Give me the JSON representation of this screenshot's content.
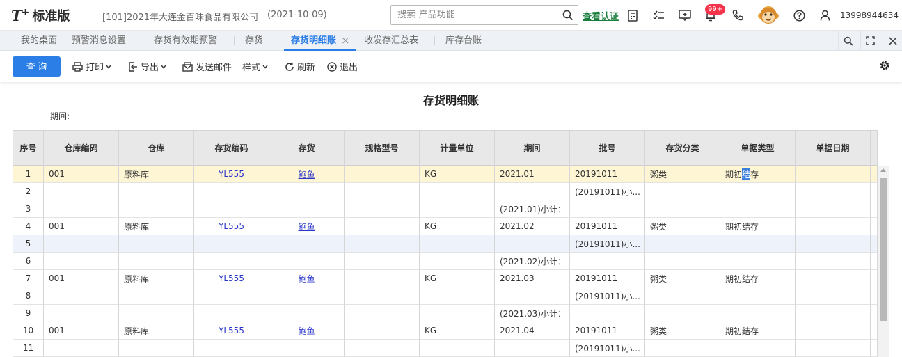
{
  "header": {
    "logo_t": "T",
    "logo_plus": "+",
    "logo_name": "标准版",
    "company": "[101]2021年大连金百味食品有限公司",
    "date": "(2021-10-09)",
    "search_placeholder": "搜索-产品功能",
    "verify_link": "查看认证",
    "notification_badge": "99+",
    "phone": "13998944634",
    "icons": [
      "calculator-icon",
      "checklist-icon",
      "message-icon",
      "bell-icon",
      "phone-icon",
      "avatar",
      "help-icon",
      "user-icon"
    ]
  },
  "tabs": {
    "items": [
      "我的桌面",
      "预警消息设置",
      "存货有效期预警",
      "存货",
      "存货明细账",
      "收发存汇总表",
      "库存台账"
    ],
    "active": "存货明细账",
    "close_glyph": "×"
  },
  "toolbar": {
    "query": "查 询",
    "print": "打印",
    "export": "导出",
    "send_email": "发送邮件",
    "style": "样式",
    "refresh": "刷新",
    "exit": "退出"
  },
  "report": {
    "title": "存货明细账",
    "period_label": "期间:"
  },
  "table": {
    "columns": [
      "序号",
      "仓库编码",
      "仓库",
      "存货编码",
      "存货",
      "规格型号",
      "计量单位",
      "期间",
      "批号",
      "存货分类",
      "单据类型",
      "单据日期"
    ],
    "rows": [
      {
        "seq": "1",
        "wh_code": "001",
        "wh": "原料库",
        "inv_code": "YL555",
        "inv": "鲍鱼",
        "spec": "",
        "unit": "KG",
        "period": "2021.01",
        "batch": "20191011",
        "category": "粥类",
        "doc_type_a": "期初",
        "doc_type_hl": "结",
        "doc_type_b": "存",
        "doc_date": ""
      },
      {
        "seq": "2",
        "wh_code": "",
        "wh": "",
        "inv_code": "",
        "inv": "",
        "spec": "",
        "unit": "",
        "period": "",
        "batch": "(20191011)小...",
        "category": "",
        "doc_type_a": "",
        "doc_type_hl": "",
        "doc_type_b": "",
        "doc_date": ""
      },
      {
        "seq": "3",
        "wh_code": "",
        "wh": "",
        "inv_code": "",
        "inv": "",
        "spec": "",
        "unit": "",
        "period": "(2021.01)小计：",
        "batch": "",
        "category": "",
        "doc_type_a": "",
        "doc_type_hl": "",
        "doc_type_b": "",
        "doc_date": ""
      },
      {
        "seq": "4",
        "wh_code": "001",
        "wh": "原料库",
        "inv_code": "YL555",
        "inv": "鲍鱼",
        "spec": "",
        "unit": "KG",
        "period": "2021.02",
        "batch": "20191011",
        "category": "粥类",
        "doc_type_a": "期初结存",
        "doc_type_hl": "",
        "doc_type_b": "",
        "doc_date": ""
      },
      {
        "seq": "5",
        "wh_code": "",
        "wh": "",
        "inv_code": "",
        "inv": "",
        "spec": "",
        "unit": "",
        "period": "",
        "batch": "(20191011)小...",
        "category": "",
        "doc_type_a": "",
        "doc_type_hl": "",
        "doc_type_b": "",
        "doc_date": ""
      },
      {
        "seq": "6",
        "wh_code": "",
        "wh": "",
        "inv_code": "",
        "inv": "",
        "spec": "",
        "unit": "",
        "period": "(2021.02)小计：",
        "batch": "",
        "category": "",
        "doc_type_a": "",
        "doc_type_hl": "",
        "doc_type_b": "",
        "doc_date": ""
      },
      {
        "seq": "7",
        "wh_code": "001",
        "wh": "原料库",
        "inv_code": "YL555",
        "inv": "鲍鱼",
        "spec": "",
        "unit": "KG",
        "period": "2021.03",
        "batch": "20191011",
        "category": "粥类",
        "doc_type_a": "期初结存",
        "doc_type_hl": "",
        "doc_type_b": "",
        "doc_date": ""
      },
      {
        "seq": "8",
        "wh_code": "",
        "wh": "",
        "inv_code": "",
        "inv": "",
        "spec": "",
        "unit": "",
        "period": "",
        "batch": "(20191011)小...",
        "category": "",
        "doc_type_a": "",
        "doc_type_hl": "",
        "doc_type_b": "",
        "doc_date": ""
      },
      {
        "seq": "9",
        "wh_code": "",
        "wh": "",
        "inv_code": "",
        "inv": "",
        "spec": "",
        "unit": "",
        "period": "(2021.03)小计：",
        "batch": "",
        "category": "",
        "doc_type_a": "",
        "doc_type_hl": "",
        "doc_type_b": "",
        "doc_date": ""
      },
      {
        "seq": "10",
        "wh_code": "001",
        "wh": "原料库",
        "inv_code": "YL555",
        "inv": "鲍鱼",
        "spec": "",
        "unit": "KG",
        "period": "2021.04",
        "batch": "20191011",
        "category": "粥类",
        "doc_type_a": "期初结存",
        "doc_type_hl": "",
        "doc_type_b": "",
        "doc_date": ""
      },
      {
        "seq": "11",
        "wh_code": "",
        "wh": "",
        "inv_code": "",
        "inv": "",
        "spec": "",
        "unit": "",
        "period": "",
        "batch": "(20191011)小...",
        "category": "",
        "doc_type_a": "",
        "doc_type_hl": "",
        "doc_type_b": "",
        "doc_date": ""
      }
    ],
    "selected_row": "1",
    "highlighted_row": "5"
  },
  "colors": {
    "primary": "#2b7ee6",
    "selected_row": "#fdf5d4",
    "alt_row": "#eef3fb",
    "link": "#2a36c9",
    "verify": "#1a7f3c",
    "badge": "#f5334a"
  }
}
